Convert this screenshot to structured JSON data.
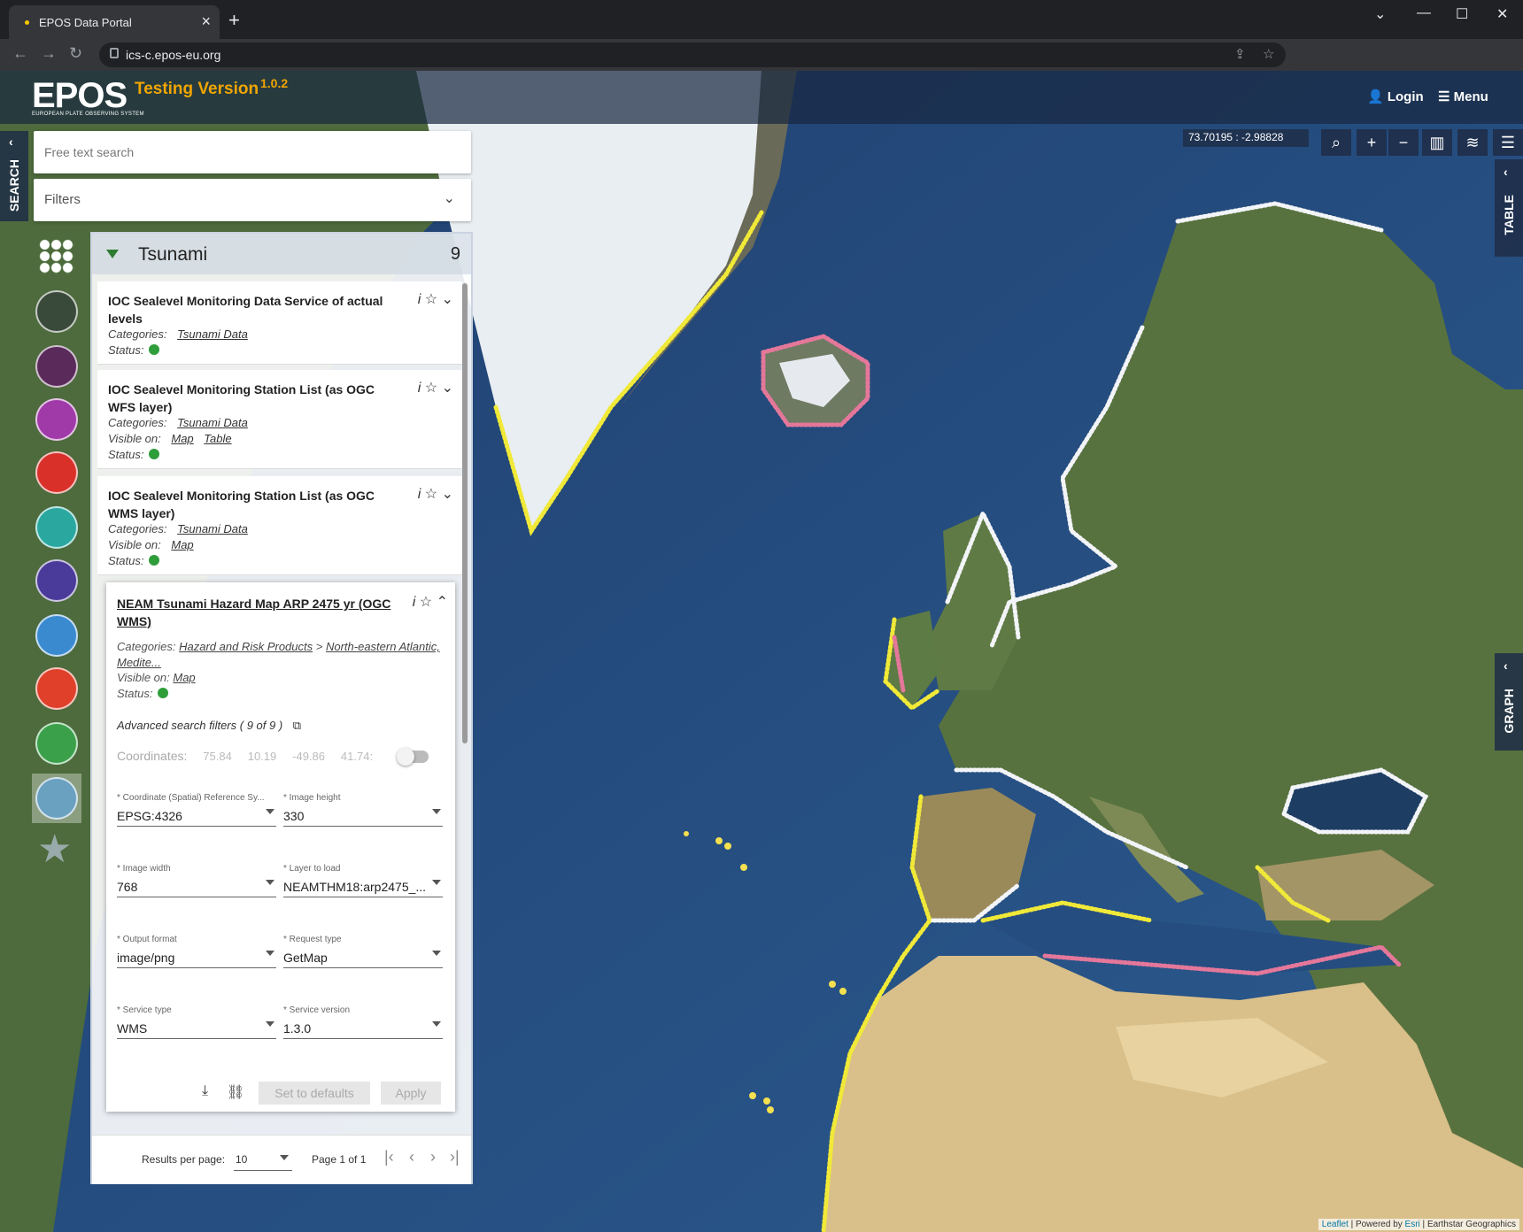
{
  "browser": {
    "tab_title": "EPOS Data Portal",
    "url": "ics-c.epos-eu.org"
  },
  "header": {
    "logo": "EPOS",
    "logo_subtitle": "EUROPEAN PLATE OBSERVING SYSTEM",
    "testing_label": "Testing Version",
    "version": "1.0.2",
    "login_label": "Login",
    "menu_label": "Menu"
  },
  "map": {
    "coordinates": "73.70195 : -2.98828",
    "table_tab": "TABLE",
    "graph_tab": "GRAPH",
    "search_tab": "SEARCH",
    "attribution": {
      "leaflet": "Leaflet",
      "powered_by": "Powered by",
      "esri": "Esri",
      "source": "Earthstar Geographics"
    }
  },
  "search": {
    "placeholder": "Free text search",
    "filters_label": "Filters"
  },
  "panel": {
    "title": "Tsunami",
    "count": "9",
    "results": [
      {
        "title": "IOC Sealevel Monitoring Data Service of actual levels",
        "categories_label": "Categories:",
        "category": "Tsunami Data",
        "status_label": "Status:"
      },
      {
        "title": "IOC Sealevel Monitoring Station List (as OGC WFS layer)",
        "categories_label": "Categories:",
        "category": "Tsunami Data",
        "visible_label": "Visible on:",
        "visible_map": "Map",
        "visible_table": "Table",
        "status_label": "Status:"
      },
      {
        "title": "IOC Sealevel Monitoring Station List (as OGC WMS layer)",
        "categories_label": "Categories:",
        "category": "Tsunami Data",
        "visible_label": "Visible on:",
        "visible_map": "Map",
        "status_label": "Status:"
      }
    ],
    "expanded": {
      "title": "NEAM Tsunami Hazard Map ARP 2475 yr (OGC WMS)",
      "categories_label": "Categories:",
      "category_1": "Hazard and Risk Products",
      "category_sep": ">",
      "category_2": "North-eastern Atlantic, Medite...",
      "visible_label": "Visible on:",
      "visible_map": "Map",
      "status_label": "Status:",
      "advanced_label": "Advanced search filters",
      "advanced_count": "( 9 of 9 )",
      "coords_label": "Coordinates:",
      "coords": [
        "75.84",
        "10.19",
        "-49.86",
        "41.74:"
      ],
      "fields": [
        {
          "label": "* Coordinate (Spatial) Reference Sy...",
          "value": "EPSG:4326"
        },
        {
          "label": "* Image height",
          "value": "330"
        },
        {
          "label": "* Image width",
          "value": "768"
        },
        {
          "label": "* Layer to load",
          "value": "NEAMTHM18:arp2475_..."
        },
        {
          "label": "* Output format",
          "value": "image/png"
        },
        {
          "label": "* Request type",
          "value": "GetMap"
        },
        {
          "label": "* Service type",
          "value": "WMS"
        },
        {
          "label": "* Service version",
          "value": "1.3.0"
        }
      ],
      "defaults_label": "Set to defaults",
      "apply_label": "Apply"
    },
    "pager": {
      "per_page_label": "Results per page:",
      "per_page": "10",
      "page_info": "Page 1 of 1"
    }
  },
  "colors": {
    "accent": "#f0a500",
    "status_ok": "#2e9d3a",
    "ocean": "#23477a"
  }
}
